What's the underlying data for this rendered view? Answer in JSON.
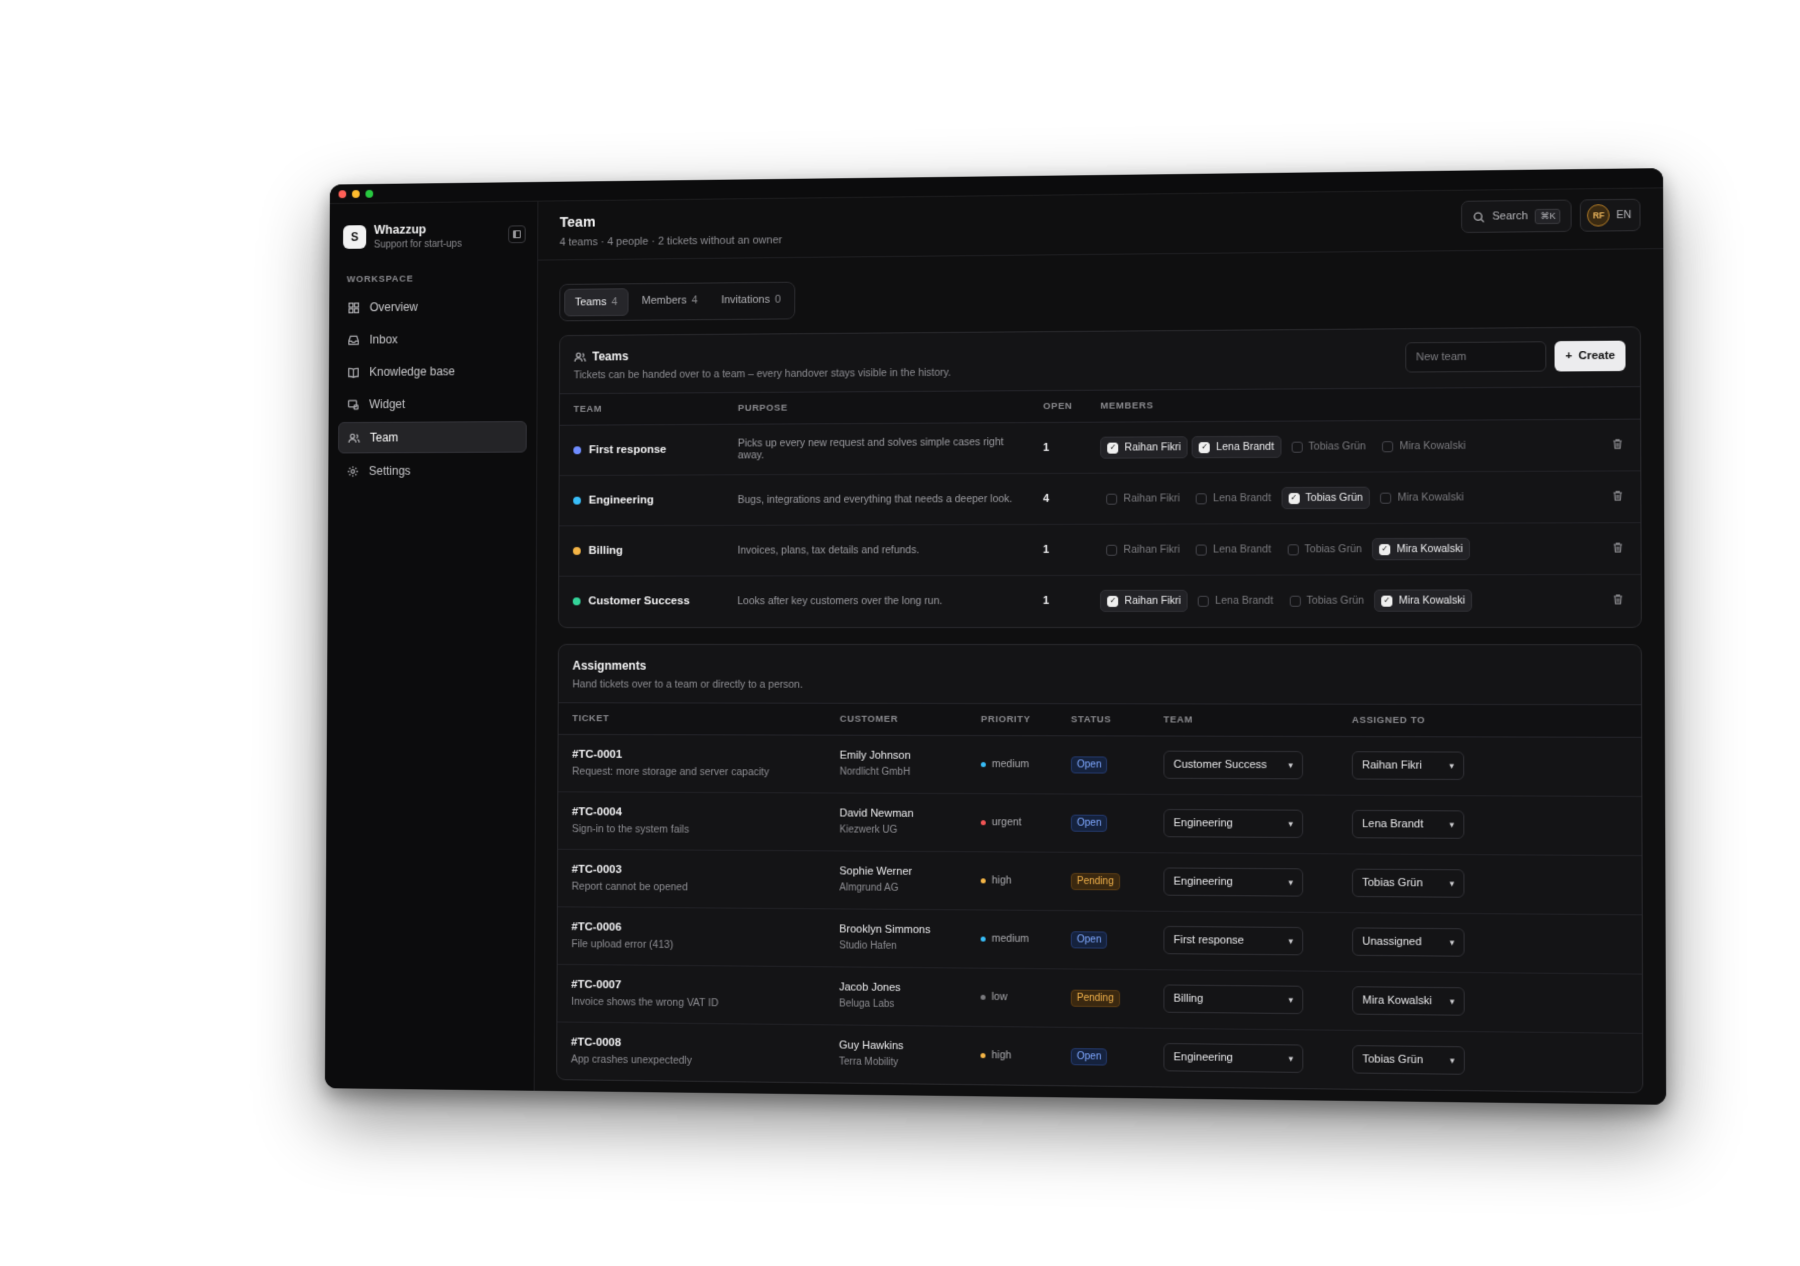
{
  "workspace": {
    "logo_letter": "S",
    "name": "Whazzup",
    "subtitle": "Support for start-ups"
  },
  "sidebar": {
    "section_label": "WORKSPACE",
    "items": [
      {
        "label": "Overview",
        "icon": "grid-icon"
      },
      {
        "label": "Inbox",
        "icon": "inbox-icon"
      },
      {
        "label": "Knowledge base",
        "icon": "book-icon"
      },
      {
        "label": "Widget",
        "icon": "widget-icon"
      },
      {
        "label": "Team",
        "icon": "users-icon",
        "active": true
      },
      {
        "label": "Settings",
        "icon": "gear-icon"
      }
    ]
  },
  "header": {
    "title": "Team",
    "subtitle": "4 teams · 4 people · 2 tickets without an owner",
    "search_label": "Search",
    "search_shortcut": "⌘K",
    "avatar_initials": "RF",
    "language": "EN"
  },
  "tabs": [
    {
      "label": "Teams",
      "count": "4",
      "active": true
    },
    {
      "label": "Members",
      "count": "4"
    },
    {
      "label": "Invitations",
      "count": "0"
    }
  ],
  "teams_card": {
    "title": "Teams",
    "description": "Tickets can be handed over to a team – every handover stays visible in the history.",
    "new_team_placeholder": "New team",
    "create_label": "Create",
    "columns": [
      "TEAM",
      "PURPOSE",
      "OPEN",
      "MEMBERS"
    ],
    "member_names": [
      "Raihan Fikri",
      "Lena Brandt",
      "Tobias Grün",
      "Mira Kowalski"
    ],
    "rows": [
      {
        "name": "First response",
        "color": "#6f8cff",
        "purpose": "Picks up every new request and solves simple cases right away.",
        "open": "1",
        "members": [
          true,
          true,
          false,
          false
        ]
      },
      {
        "name": "Engineering",
        "color": "#38bdf8",
        "purpose": "Bugs, integrations and everything that needs a deeper look.",
        "open": "4",
        "members": [
          false,
          false,
          true,
          false
        ]
      },
      {
        "name": "Billing",
        "color": "#f5b546",
        "purpose": "Invoices, plans, tax details and refunds.",
        "open": "1",
        "members": [
          false,
          false,
          false,
          true
        ]
      },
      {
        "name": "Customer Success",
        "color": "#34d399",
        "purpose": "Looks after key customers over the long run.",
        "open": "1",
        "members": [
          true,
          false,
          false,
          true
        ]
      }
    ]
  },
  "assignments_card": {
    "title": "Assignments",
    "description": "Hand tickets over to a team or directly to a person.",
    "columns": [
      "TICKET",
      "CUSTOMER",
      "PRIORITY",
      "STATUS",
      "TEAM",
      "ASSIGNED TO"
    ],
    "rows": [
      {
        "id": "#TC-0001",
        "subject": "Request: more storage and server capacity",
        "customer": "Emily Johnson",
        "company": "Nordlicht GmbH",
        "priority": "medium",
        "priority_color": "#38bdf8",
        "status": "Open",
        "team": "Customer Success",
        "assignee": "Raihan Fikri"
      },
      {
        "id": "#TC-0004",
        "subject": "Sign-in to the system fails",
        "customer": "David Newman",
        "company": "Kiezwerk UG",
        "priority": "urgent",
        "priority_color": "#f25555",
        "status": "Open",
        "team": "Engineering",
        "assignee": "Lena Brandt"
      },
      {
        "id": "#TC-0003",
        "subject": "Report cannot be opened",
        "customer": "Sophie Werner",
        "company": "Almgrund AG",
        "priority": "high",
        "priority_color": "#f5b546",
        "status": "Pending",
        "team": "Engineering",
        "assignee": "Tobias Grün"
      },
      {
        "id": "#TC-0006",
        "subject": "File upload error (413)",
        "customer": "Brooklyn Simmons",
        "company": "Studio Hafen",
        "priority": "medium",
        "priority_color": "#38bdf8",
        "status": "Open",
        "team": "First response",
        "assignee": "Unassigned"
      },
      {
        "id": "#TC-0007",
        "subject": "Invoice shows the wrong VAT ID",
        "customer": "Jacob Jones",
        "company": "Beluga Labs",
        "priority": "low",
        "priority_color": "#7a7a7e",
        "status": "Pending",
        "team": "Billing",
        "assignee": "Mira Kowalski"
      },
      {
        "id": "#TC-0008",
        "subject": "App crashes unexpectedly",
        "customer": "Guy Hawkins",
        "company": "Terra Mobility",
        "priority": "high",
        "priority_color": "#f5b546",
        "status": "Open",
        "team": "Engineering",
        "assignee": "Tobias Grün"
      }
    ]
  }
}
